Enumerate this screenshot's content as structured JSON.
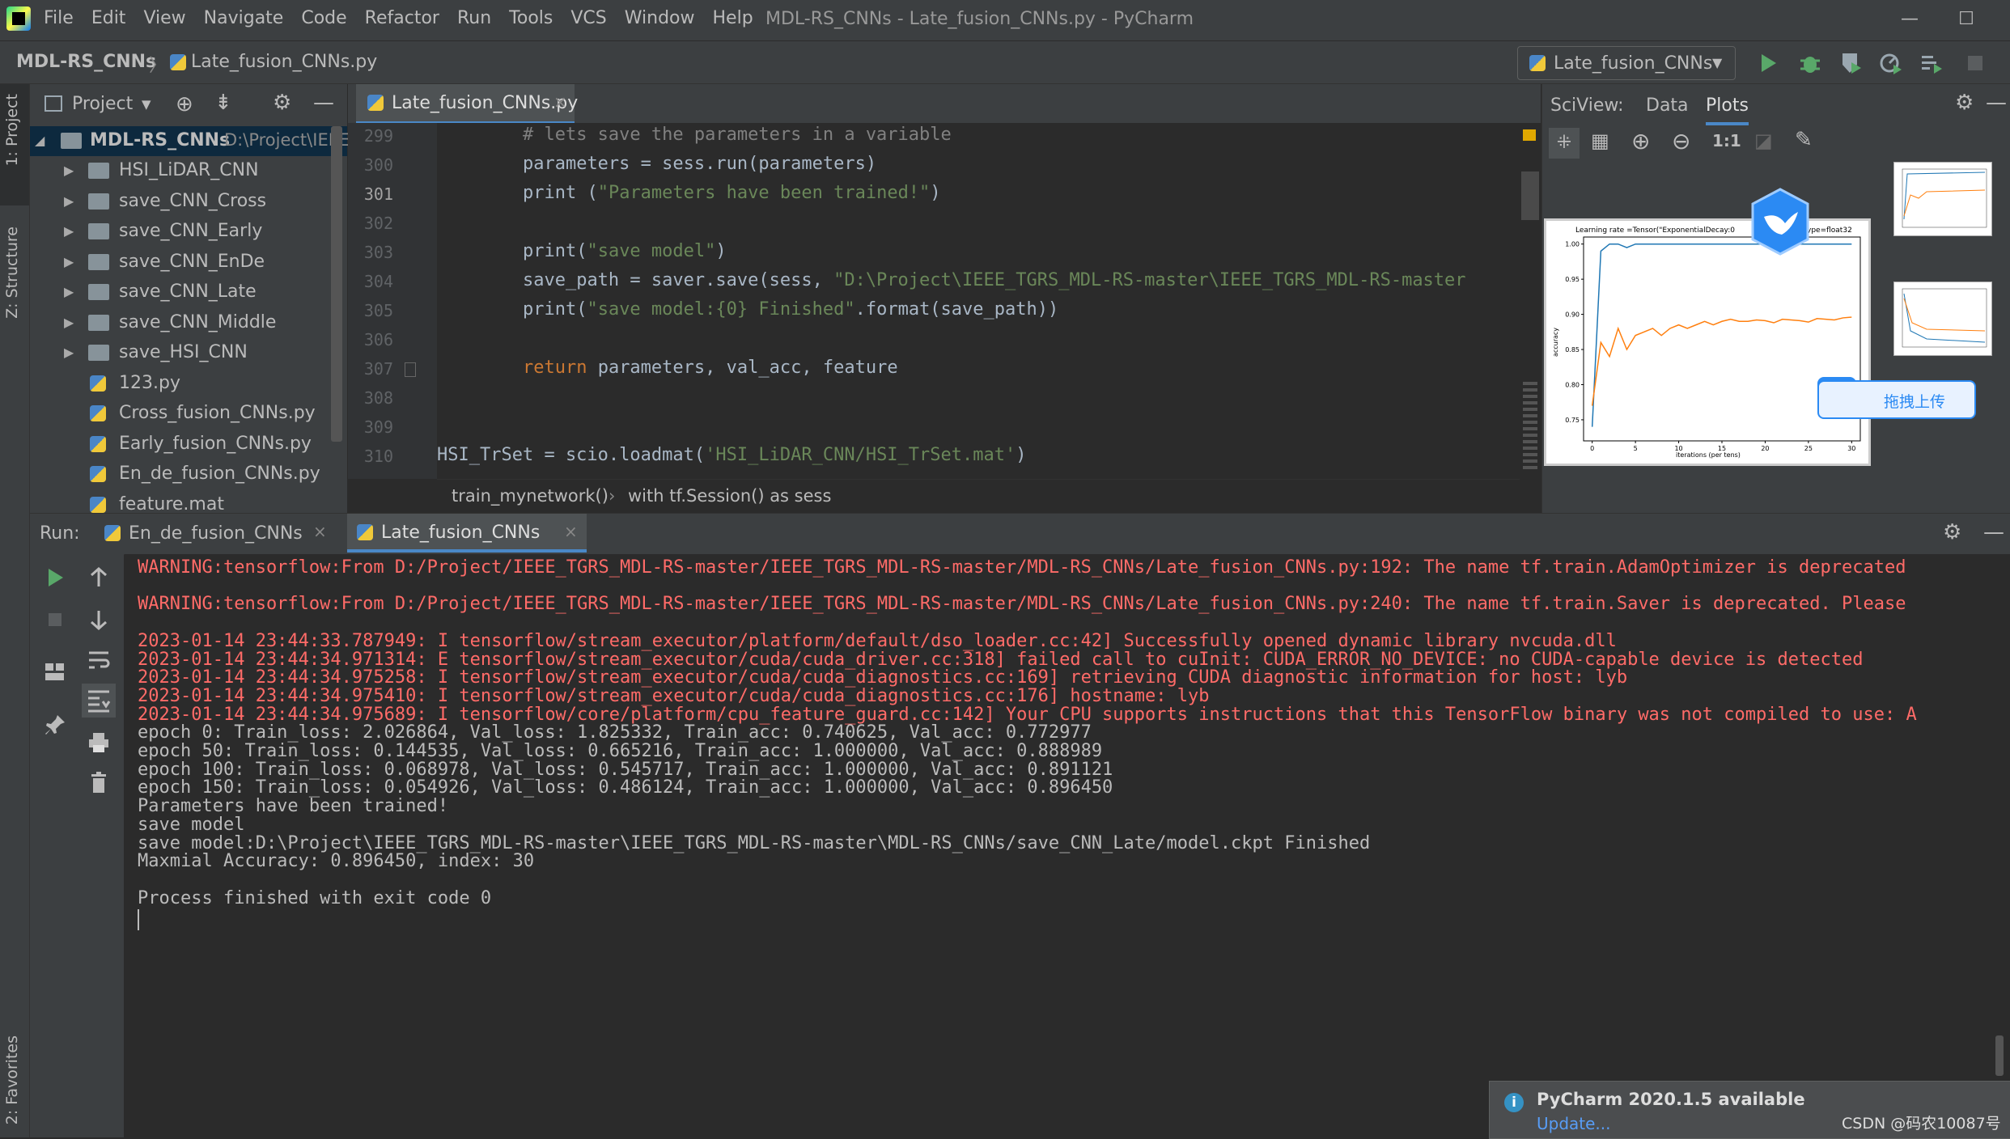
{
  "window": {
    "title": "MDL-RS_CNNs - Late_fusion_CNNs.py - PyCharm",
    "minimize": "—",
    "maximize": "☐"
  },
  "menu": [
    "File",
    "Edit",
    "View",
    "Navigate",
    "Code",
    "Refactor",
    "Run",
    "Tools",
    "VCS",
    "Window",
    "Help"
  ],
  "breadcrumb": {
    "project": "MDL-RS_CNNs",
    "separator": "〉",
    "file": "Late_fusion_CNNs.py"
  },
  "run_config": {
    "label": "Late_fusion_CNNs"
  },
  "left_stripe": {
    "project": "1: Project",
    "structure": "Z: Structure",
    "favorites": "2: Favorites"
  },
  "project_panel": {
    "title": "Project",
    "root": {
      "name": "MDL-RS_CNNs",
      "path": "D:\\Project\\IEEE"
    },
    "items": [
      {
        "name": "HSI_LiDAR_CNN",
        "type": "folder"
      },
      {
        "name": "save_CNN_Cross",
        "type": "folder"
      },
      {
        "name": "save_CNN_Early",
        "type": "folder"
      },
      {
        "name": "save_CNN_EnDe",
        "type": "folder"
      },
      {
        "name": "save_CNN_Late",
        "type": "folder"
      },
      {
        "name": "save_CNN_Middle",
        "type": "folder"
      },
      {
        "name": "save_HSI_CNN",
        "type": "folder"
      },
      {
        "name": "123.py",
        "type": "file"
      },
      {
        "name": "Cross_fusion_CNNs.py",
        "type": "file"
      },
      {
        "name": "Early_fusion_CNNs.py",
        "type": "file"
      },
      {
        "name": "En_de_fusion_CNNs.py",
        "type": "file"
      },
      {
        "name": "feature.mat",
        "type": "file"
      }
    ]
  },
  "editor": {
    "tab": "Late_fusion_CNNs.py",
    "line_numbers": [
      "299",
      "300",
      "301",
      "302",
      "303",
      "304",
      "305",
      "306",
      "307",
      "308",
      "309",
      "310"
    ],
    "lines": [
      {
        "indent": "        ",
        "parts": [
          {
            "t": "# lets save the parameters in a variable",
            "c": "cmt"
          }
        ]
      },
      {
        "indent": "        ",
        "parts": [
          {
            "t": "parameters = sess.run(parameters)",
            "c": ""
          }
        ]
      },
      {
        "indent": "        ",
        "parts": [
          {
            "t": "print ",
            "c": ""
          },
          {
            "t": "(",
            "c": ""
          },
          {
            "t": "\"Parameters have been trained!\"",
            "c": "str"
          },
          {
            "t": ")",
            "c": ""
          }
        ]
      },
      {
        "indent": "",
        "parts": []
      },
      {
        "indent": "        ",
        "parts": [
          {
            "t": "print(",
            "c": ""
          },
          {
            "t": "\"save model\"",
            "c": "str"
          },
          {
            "t": ")",
            "c": ""
          }
        ]
      },
      {
        "indent": "        ",
        "parts": [
          {
            "t": "save_path = saver.save(sess, ",
            "c": ""
          },
          {
            "t": "\"D:\\Project\\IEEE_TGRS_MDL-RS-master\\IEEE_TGRS_MDL-RS-master",
            "c": "str"
          }
        ]
      },
      {
        "indent": "        ",
        "parts": [
          {
            "t": "print(",
            "c": ""
          },
          {
            "t": "\"save model:{0} Finished\"",
            "c": "str"
          },
          {
            "t": ".format(save_path))",
            "c": ""
          }
        ]
      },
      {
        "indent": "",
        "parts": []
      },
      {
        "indent": "        ",
        "parts": [
          {
            "t": "return",
            "c": "kw"
          },
          {
            "t": " parameters, val_acc, feature",
            "c": ""
          }
        ]
      },
      {
        "indent": "",
        "parts": []
      },
      {
        "indent": "",
        "parts": []
      },
      {
        "indent": "",
        "parts": [
          {
            "t": "HSI_TrSet = scio.loadmat(",
            "c": ""
          },
          {
            "t": "'HSI_LiDAR_CNN/HSI_TrSet.mat'",
            "c": "str"
          },
          {
            "t": ")",
            "c": ""
          }
        ]
      }
    ],
    "crumbs": [
      "train_mynetwork()",
      "with tf.Session() as sess"
    ]
  },
  "sciview": {
    "title": "SciView:",
    "tabs": [
      "Data",
      "Plots"
    ],
    "active_tab": "Plots",
    "zoom_label": "1:1",
    "plot_title": "Learning rate =Tensor(\"ExponentialDecay:0",
    "plot_title_right": "ype=float32",
    "xlabel": "iterations (per tens)",
    "ylabel": "accuracy",
    "upload_label": "拖拽上传"
  },
  "chart_data": {
    "type": "line",
    "x": [
      0,
      1,
      2,
      3,
      4,
      5,
      6,
      7,
      8,
      9,
      10,
      11,
      12,
      13,
      14,
      15,
      16,
      17,
      18,
      19,
      20,
      21,
      22,
      23,
      24,
      25,
      26,
      27,
      28,
      29,
      30
    ],
    "xticks": [
      "0",
      "5",
      "10",
      "15",
      "20",
      "25",
      "30"
    ],
    "yticks": [
      "0.75",
      "0.80",
      "0.85",
      "0.90",
      "0.95",
      "1.00"
    ],
    "ylim": [
      0.72,
      1.01
    ],
    "xlim": [
      -1,
      31
    ],
    "series": [
      {
        "color": "#1f77b4",
        "values": [
          0.74,
          0.99,
          1.0,
          1.0,
          0.995,
          1.0,
          1.0,
          1.0,
          1.0,
          1.0,
          1.0,
          1.0,
          1.0,
          1.0,
          1.0,
          1.0,
          1.0,
          1.0,
          1.0,
          1.0,
          1.0,
          1.0,
          1.0,
          1.0,
          1.0,
          1.0,
          1.0,
          1.0,
          1.0,
          1.0,
          1.0
        ]
      },
      {
        "color": "#ff7f0e",
        "values": [
          0.77,
          0.86,
          0.84,
          0.88,
          0.85,
          0.87,
          0.875,
          0.88,
          0.87,
          0.88,
          0.885,
          0.88,
          0.885,
          0.89,
          0.885,
          0.89,
          0.893,
          0.89,
          0.89,
          0.892,
          0.891,
          0.888,
          0.893,
          0.892,
          0.891,
          0.889,
          0.894,
          0.893,
          0.892,
          0.895,
          0.896
        ]
      }
    ]
  },
  "run_panel": {
    "label": "Run:",
    "tabs": [
      "En_de_fusion_CNNs",
      "Late_fusion_CNNs"
    ],
    "active_tab": "Late_fusion_CNNs",
    "lines": [
      {
        "t": "WARNING:tensorflow:From D:/Project/IEEE_TGRS_MDL-RS-master/IEEE_TGRS_MDL-RS-master/MDL-RS_CNNs/Late_fusion_CNNs.py:192: The name tf.train.AdamOptimizer is deprecated",
        "c": "err"
      },
      {
        "t": "",
        "c": "out"
      },
      {
        "t": "WARNING:tensorflow:From D:/Project/IEEE_TGRS_MDL-RS-master/IEEE_TGRS_MDL-RS-master/MDL-RS_CNNs/Late_fusion_CNNs.py:240: The name tf.train.Saver is deprecated. Please",
        "c": "err"
      },
      {
        "t": "",
        "c": "out"
      },
      {
        "t": "2023-01-14 23:44:33.787949: I tensorflow/stream_executor/platform/default/dso_loader.cc:42] Successfully opened dynamic library nvcuda.dll",
        "c": "err"
      },
      {
        "t": "2023-01-14 23:44:34.971314: E tensorflow/stream_executor/cuda/cuda_driver.cc:318] failed call to cuInit: CUDA_ERROR_NO_DEVICE: no CUDA-capable device is detected",
        "c": "err"
      },
      {
        "t": "2023-01-14 23:44:34.975258: I tensorflow/stream_executor/cuda/cuda_diagnostics.cc:169] retrieving CUDA diagnostic information for host: lyb",
        "c": "err"
      },
      {
        "t": "2023-01-14 23:44:34.975410: I tensorflow/stream_executor/cuda/cuda_diagnostics.cc:176] hostname: lyb",
        "c": "err"
      },
      {
        "t": "2023-01-14 23:44:34.975689: I tensorflow/core/platform/cpu_feature_guard.cc:142] Your CPU supports instructions that this TensorFlow binary was not compiled to use: A",
        "c": "err"
      },
      {
        "t": "epoch 0: Train_loss: 2.026864, Val_loss: 1.825332, Train_acc: 0.740625, Val_acc: 0.772977",
        "c": "out"
      },
      {
        "t": "epoch 50: Train_loss: 0.144535, Val_loss: 0.665216, Train_acc: 1.000000, Val_acc: 0.888989",
        "c": "out"
      },
      {
        "t": "epoch 100: Train_loss: 0.068978, Val_loss: 0.545717, Train_acc: 1.000000, Val_acc: 0.891121",
        "c": "out"
      },
      {
        "t": "epoch 150: Train_loss: 0.054926, Val_loss: 0.486124, Train_acc: 1.000000, Val_acc: 0.896450",
        "c": "out"
      },
      {
        "t": "Parameters have been trained!",
        "c": "out"
      },
      {
        "t": "save model",
        "c": "out"
      },
      {
        "t": "save model:D:\\Project\\IEEE_TGRS_MDL-RS-master\\IEEE_TGRS_MDL-RS-master\\MDL-RS_CNNs/save_CNN_Late/model.ckpt Finished",
        "c": "out"
      },
      {
        "t": "Maxmial Accuracy: 0.896450, index: 30",
        "c": "out"
      },
      {
        "t": "",
        "c": "out"
      },
      {
        "t": "Process finished with exit code 0",
        "c": "out"
      }
    ]
  },
  "notification": {
    "title": "PyCharm 2020.1.5 available",
    "link": "Update..."
  },
  "watermark": "CSDN @码农10087号"
}
